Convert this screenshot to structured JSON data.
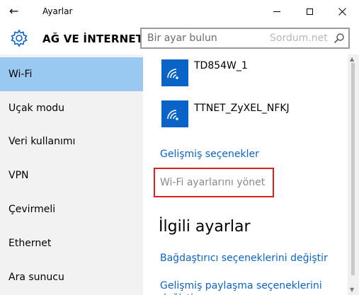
{
  "window": {
    "title": "Ayarlar"
  },
  "header": {
    "title": "AĞ VE İNTERNET",
    "search_placeholder": "Bir ayar bulun",
    "watermark": "Sordum.net"
  },
  "sidebar": {
    "items": [
      {
        "label": "Wi-Fi",
        "active": true
      },
      {
        "label": "Uçak modu",
        "active": false
      },
      {
        "label": "Veri kullanımı",
        "active": false
      },
      {
        "label": "VPN",
        "active": false
      },
      {
        "label": "Çevirmeli",
        "active": false
      },
      {
        "label": "Ethernet",
        "active": false
      },
      {
        "label": "Ara sunucu",
        "active": false
      }
    ]
  },
  "networks": [
    {
      "name": "TD854W_1"
    },
    {
      "name": "TTNET_ZyXEL_NFKJ"
    }
  ],
  "main": {
    "advanced_link": "Gelişmiş seçenekler",
    "manage_wifi": "Wi-Fi ayarlarını yönet",
    "related_heading": "İlgili ayarlar",
    "related_links": [
      "Bağdaştırıcı seçeneklerini değiştir",
      "Gelişmiş paylaşma seçeneklerini değiştir"
    ]
  },
  "colors": {
    "accent": "#0a64c8",
    "active_nav": "#99c8f0",
    "highlight_box": "#e02020"
  }
}
